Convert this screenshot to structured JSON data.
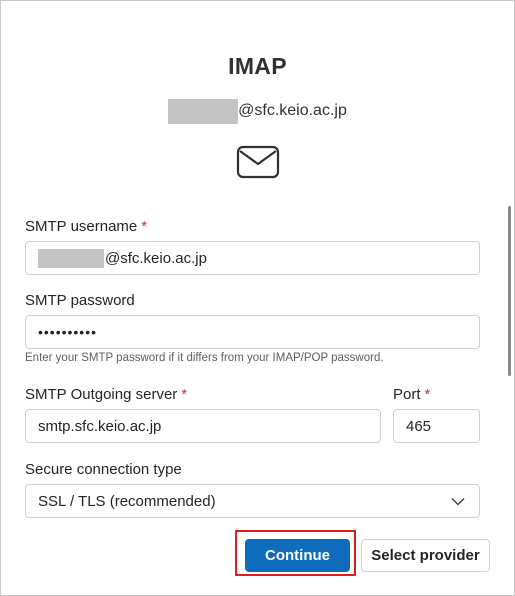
{
  "header": {
    "title": "IMAP",
    "account_domain": "@sfc.keio.ac.jp"
  },
  "icons": {
    "mail": "mail-icon",
    "dropdown": "chevron-down-icon"
  },
  "form": {
    "smtp_username": {
      "label": "SMTP username",
      "required_mark": "*",
      "value": "@sfc.keio.ac.jp"
    },
    "smtp_password": {
      "label": "SMTP password",
      "value": "••••••••••",
      "hint": "Enter your SMTP password if it differs from your IMAP/POP password."
    },
    "smtp_server": {
      "label": "SMTP Outgoing server",
      "required_mark": "*",
      "value": "smtp.sfc.keio.ac.jp"
    },
    "port": {
      "label": "Port",
      "required_mark": "*",
      "value": "465"
    },
    "secure_connection": {
      "label": "Secure connection type",
      "value": "SSL / TLS (recommended)"
    }
  },
  "buttons": {
    "continue": "Continue",
    "select_provider": "Select provider"
  },
  "colors": {
    "primary": "#0f6cbd",
    "required": "#c4314b",
    "highlight": "#e01e1e"
  }
}
